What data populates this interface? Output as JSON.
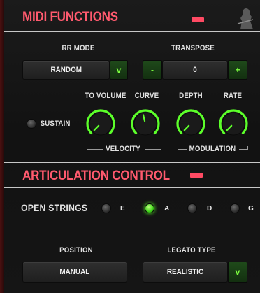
{
  "midi": {
    "title": "MIDI FUNCTIONS",
    "rr_mode": {
      "label": "RR MODE",
      "value": "RANDOM",
      "dropdown_icon": "v"
    },
    "transpose": {
      "label": "TRANSPOSE",
      "value": "0",
      "minus": "-",
      "plus": "+"
    },
    "sustain": {
      "label": "SUSTAIN",
      "on": false
    },
    "knobs": [
      {
        "label": "TO VOLUME",
        "value": 0.0
      },
      {
        "label": "CURVE",
        "value": 0.45
      },
      {
        "label": "DEPTH",
        "value": 0.0
      },
      {
        "label": "RATE",
        "value": 0.0
      }
    ],
    "velocity_label": "VELOCITY",
    "modulation_label": "MODULATION"
  },
  "articulation": {
    "title": "ARTICULATION CONTROL",
    "open_strings": {
      "label": "OPEN STRINGS",
      "options": [
        {
          "label": "E",
          "on": false
        },
        {
          "label": "A",
          "on": true
        },
        {
          "label": "D",
          "on": false
        },
        {
          "label": "G",
          "on": false
        }
      ]
    },
    "position": {
      "label": "POSITION",
      "value": "MANUAL"
    },
    "legato": {
      "label": "LEGATO TYPE",
      "value": "REALISTIC",
      "dropdown_icon": "v"
    }
  },
  "colors": {
    "accent": "#ff5a6e",
    "green": "#5cff2a"
  }
}
